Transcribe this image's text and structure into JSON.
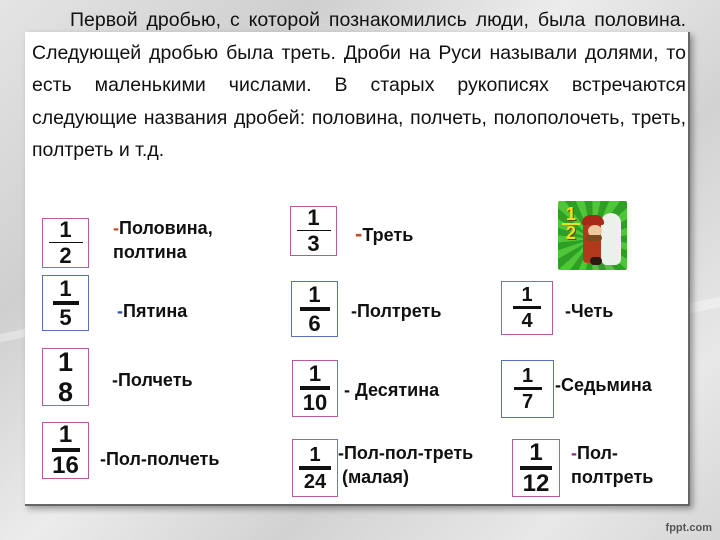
{
  "slide": {
    "intro_text": "Первой дробью, с которой познакомились люди, была половина. Следующей дробью была треть. Дроби на Руси называли долями, то есть маленькими числами. В старых рукописях встречаются следующие названия дробей: половина, полчеть, полополочеть, треть, полтреть и т.д.",
    "fractions": [
      {
        "numerator": "1",
        "denominator": "2",
        "name": "-Половина,",
        "name_line2": "полтина",
        "dash_color": "#c0502a"
      },
      {
        "numerator": "1",
        "denominator": "5",
        "name": "-Пятина",
        "dash_color": "#2b4fa6"
      },
      {
        "numerator": "1",
        "denominator": "8",
        "name": "-Полчеть"
      },
      {
        "numerator": "1",
        "denominator": "16",
        "name": "-Пол-полчеть"
      },
      {
        "numerator": "1",
        "denominator": "3",
        "name": "-Треть",
        "dash_color": "#c0502a"
      },
      {
        "numerator": "1",
        "denominator": "6",
        "name": "-Полтреть"
      },
      {
        "numerator": "1",
        "denominator": "10",
        "name": "- Десятина"
      },
      {
        "numerator": "1",
        "denominator": "24",
        "name": "-Пол-пол-треть",
        "name_line2": "(малая)"
      },
      {
        "numerator": "1",
        "denominator": "4",
        "name": "-Четь"
      },
      {
        "numerator": "1",
        "denominator": "7",
        "name": "-Седьмина"
      },
      {
        "numerator": "1",
        "denominator": "12",
        "name": "-Пол-",
        "name_line2": "полтреть",
        "dash_color": "#8a2a7a"
      }
    ],
    "game_icon": {
      "label_num": "1",
      "label_den": "2",
      "description": "half-mario-icon"
    },
    "watermark": "fppt.com"
  }
}
